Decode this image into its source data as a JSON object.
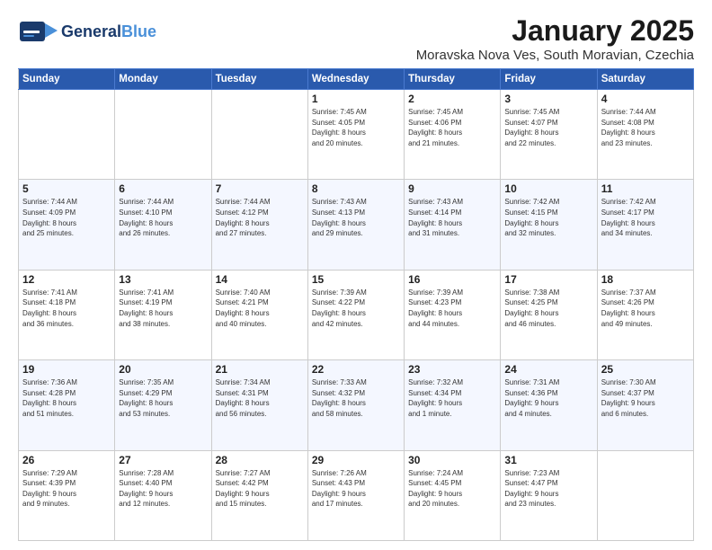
{
  "header": {
    "logo_line1a": "General",
    "logo_line1b": "Blue",
    "month": "January 2025",
    "location": "Moravska Nova Ves, South Moravian, Czechia"
  },
  "days_of_week": [
    "Sunday",
    "Monday",
    "Tuesday",
    "Wednesday",
    "Thursday",
    "Friday",
    "Saturday"
  ],
  "weeks": [
    [
      {
        "num": "",
        "info": ""
      },
      {
        "num": "",
        "info": ""
      },
      {
        "num": "",
        "info": ""
      },
      {
        "num": "1",
        "info": "Sunrise: 7:45 AM\nSunset: 4:05 PM\nDaylight: 8 hours\nand 20 minutes."
      },
      {
        "num": "2",
        "info": "Sunrise: 7:45 AM\nSunset: 4:06 PM\nDaylight: 8 hours\nand 21 minutes."
      },
      {
        "num": "3",
        "info": "Sunrise: 7:45 AM\nSunset: 4:07 PM\nDaylight: 8 hours\nand 22 minutes."
      },
      {
        "num": "4",
        "info": "Sunrise: 7:44 AM\nSunset: 4:08 PM\nDaylight: 8 hours\nand 23 minutes."
      }
    ],
    [
      {
        "num": "5",
        "info": "Sunrise: 7:44 AM\nSunset: 4:09 PM\nDaylight: 8 hours\nand 25 minutes."
      },
      {
        "num": "6",
        "info": "Sunrise: 7:44 AM\nSunset: 4:10 PM\nDaylight: 8 hours\nand 26 minutes."
      },
      {
        "num": "7",
        "info": "Sunrise: 7:44 AM\nSunset: 4:12 PM\nDaylight: 8 hours\nand 27 minutes."
      },
      {
        "num": "8",
        "info": "Sunrise: 7:43 AM\nSunset: 4:13 PM\nDaylight: 8 hours\nand 29 minutes."
      },
      {
        "num": "9",
        "info": "Sunrise: 7:43 AM\nSunset: 4:14 PM\nDaylight: 8 hours\nand 31 minutes."
      },
      {
        "num": "10",
        "info": "Sunrise: 7:42 AM\nSunset: 4:15 PM\nDaylight: 8 hours\nand 32 minutes."
      },
      {
        "num": "11",
        "info": "Sunrise: 7:42 AM\nSunset: 4:17 PM\nDaylight: 8 hours\nand 34 minutes."
      }
    ],
    [
      {
        "num": "12",
        "info": "Sunrise: 7:41 AM\nSunset: 4:18 PM\nDaylight: 8 hours\nand 36 minutes."
      },
      {
        "num": "13",
        "info": "Sunrise: 7:41 AM\nSunset: 4:19 PM\nDaylight: 8 hours\nand 38 minutes."
      },
      {
        "num": "14",
        "info": "Sunrise: 7:40 AM\nSunset: 4:21 PM\nDaylight: 8 hours\nand 40 minutes."
      },
      {
        "num": "15",
        "info": "Sunrise: 7:39 AM\nSunset: 4:22 PM\nDaylight: 8 hours\nand 42 minutes."
      },
      {
        "num": "16",
        "info": "Sunrise: 7:39 AM\nSunset: 4:23 PM\nDaylight: 8 hours\nand 44 minutes."
      },
      {
        "num": "17",
        "info": "Sunrise: 7:38 AM\nSunset: 4:25 PM\nDaylight: 8 hours\nand 46 minutes."
      },
      {
        "num": "18",
        "info": "Sunrise: 7:37 AM\nSunset: 4:26 PM\nDaylight: 8 hours\nand 49 minutes."
      }
    ],
    [
      {
        "num": "19",
        "info": "Sunrise: 7:36 AM\nSunset: 4:28 PM\nDaylight: 8 hours\nand 51 minutes."
      },
      {
        "num": "20",
        "info": "Sunrise: 7:35 AM\nSunset: 4:29 PM\nDaylight: 8 hours\nand 53 minutes."
      },
      {
        "num": "21",
        "info": "Sunrise: 7:34 AM\nSunset: 4:31 PM\nDaylight: 8 hours\nand 56 minutes."
      },
      {
        "num": "22",
        "info": "Sunrise: 7:33 AM\nSunset: 4:32 PM\nDaylight: 8 hours\nand 58 minutes."
      },
      {
        "num": "23",
        "info": "Sunrise: 7:32 AM\nSunset: 4:34 PM\nDaylight: 9 hours\nand 1 minute."
      },
      {
        "num": "24",
        "info": "Sunrise: 7:31 AM\nSunset: 4:36 PM\nDaylight: 9 hours\nand 4 minutes."
      },
      {
        "num": "25",
        "info": "Sunrise: 7:30 AM\nSunset: 4:37 PM\nDaylight: 9 hours\nand 6 minutes."
      }
    ],
    [
      {
        "num": "26",
        "info": "Sunrise: 7:29 AM\nSunset: 4:39 PM\nDaylight: 9 hours\nand 9 minutes."
      },
      {
        "num": "27",
        "info": "Sunrise: 7:28 AM\nSunset: 4:40 PM\nDaylight: 9 hours\nand 12 minutes."
      },
      {
        "num": "28",
        "info": "Sunrise: 7:27 AM\nSunset: 4:42 PM\nDaylight: 9 hours\nand 15 minutes."
      },
      {
        "num": "29",
        "info": "Sunrise: 7:26 AM\nSunset: 4:43 PM\nDaylight: 9 hours\nand 17 minutes."
      },
      {
        "num": "30",
        "info": "Sunrise: 7:24 AM\nSunset: 4:45 PM\nDaylight: 9 hours\nand 20 minutes."
      },
      {
        "num": "31",
        "info": "Sunrise: 7:23 AM\nSunset: 4:47 PM\nDaylight: 9 hours\nand 23 minutes."
      },
      {
        "num": "",
        "info": ""
      }
    ]
  ]
}
